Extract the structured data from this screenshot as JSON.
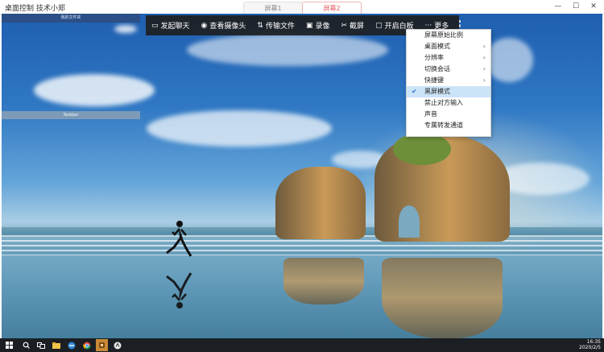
{
  "app": {
    "title": "桌面控制   技术小郑",
    "tabs": [
      "屏幕1",
      "屏幕2"
    ],
    "active_tab": "屏幕2",
    "controls": {
      "minimize": "—",
      "maximize": "☐",
      "close": "✕"
    }
  },
  "remote": {
    "mini_window_top_label": "我的文件夹",
    "mini_window_mid_label": "Taskbar"
  },
  "toolbar": {
    "items": [
      {
        "label": "发起聊天",
        "icon": "chat-icon",
        "glyph": "▭"
      },
      {
        "label": "查看摄像头",
        "icon": "camera-icon",
        "glyph": "◉"
      },
      {
        "label": "传输文件",
        "icon": "transfer-icon",
        "glyph": "⇅"
      },
      {
        "label": "录像",
        "icon": "record-icon",
        "glyph": "▣"
      },
      {
        "label": "截屏",
        "icon": "scissors-icon",
        "glyph": "✂"
      },
      {
        "label": "开启白板",
        "icon": "whiteboard-icon",
        "glyph": "▢"
      },
      {
        "label": "更多",
        "icon": "more-icon",
        "glyph": "···"
      }
    ]
  },
  "menu": {
    "items": [
      {
        "label": "屏幕原始比例",
        "submenu": false,
        "checked": false
      },
      {
        "label": "桌面模式",
        "submenu": true,
        "checked": false
      },
      {
        "label": "分辨率",
        "submenu": true,
        "checked": false
      },
      {
        "label": "切换会话",
        "submenu": true,
        "checked": false
      },
      {
        "label": "快捷键",
        "submenu": true,
        "checked": false
      },
      {
        "label": "黑屏模式",
        "submenu": false,
        "checked": true
      },
      {
        "label": "禁止对方输入",
        "submenu": false,
        "checked": false
      },
      {
        "label": "声音",
        "submenu": false,
        "checked": false
      },
      {
        "label": "专属转发通道",
        "submenu": false,
        "checked": false
      }
    ],
    "check_glyph": "✔",
    "arrow_glyph": "›"
  },
  "taskbar": {
    "time": "16:35",
    "date": "2020/2/5",
    "icons": [
      "windows-start-icon",
      "search-icon",
      "task-view-icon",
      "file-explorer-icon",
      "browser-icon",
      "chrome-icon",
      "app-icon",
      "remote-app-icon"
    ]
  }
}
